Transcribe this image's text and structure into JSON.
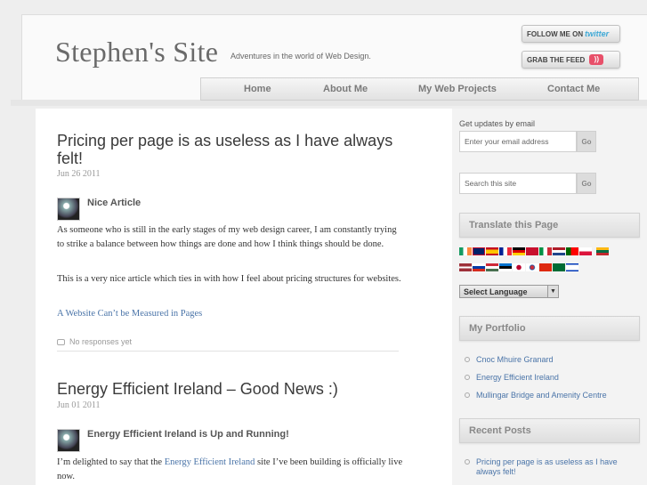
{
  "header": {
    "site_title": "Stephen's Site",
    "tagline": "Adventures in the world of Web Design.",
    "follow_label": "FOLLOW ME ON",
    "follow_brand": "twitter",
    "feed_label": "GRAB THE FEED"
  },
  "nav": {
    "items": [
      {
        "label": "Home"
      },
      {
        "label": "About Me"
      },
      {
        "label": "My Web Projects"
      },
      {
        "label": "Contact Me"
      }
    ]
  },
  "posts": [
    {
      "title": "Pricing per page is as useless as I have always felt!",
      "date": "Jun 26 2011",
      "subheading": "Nice Article",
      "paragraph1": "As someone who is still in the early stages of my web design career, I am constantly trying to strike a balance between how things are done and how I think things should be done.",
      "paragraph2": "This is a very nice article which ties in with how I feel about pricing structures for websites.",
      "link": "A Website Can’t be Measured in Pages",
      "comments": "No responses yet"
    },
    {
      "title": "Energy Efficient Ireland – Good News :)",
      "date": "Jun 01 2011",
      "subheading": "Energy Efficient Ireland is Up and Running!",
      "paragraph_before": "I’m delighted to say that the ",
      "paragraph_link": "Energy Efficient Ireland",
      "paragraph_after": " site I’ve been building is officially live now."
    }
  ],
  "sidebar": {
    "email_label": "Get updates by email",
    "email_placeholder": "Enter your email address",
    "go_label": "Go",
    "search_placeholder": "Search this site",
    "translate_title": "Translate this Page",
    "select_language": "Select Language",
    "portfolio_title": "My Portfolio",
    "portfolio_items": [
      {
        "label": "Cnoc Mhuire Granard"
      },
      {
        "label": "Energy Efficient Ireland"
      },
      {
        "label": "Mullingar Bridge and Amenity Centre"
      }
    ],
    "recent_title": "Recent Posts",
    "recent_items": [
      {
        "label": "Pricing per page is as useless as I have always felt!"
      }
    ]
  },
  "flags": [
    "ireland-flag-icon",
    "uk-flag-icon",
    "spain-flag-icon",
    "france-flag-icon",
    "germany-flag-icon",
    "denmark-flag-icon",
    "italy-flag-icon",
    "netherlands-flag-icon",
    "portugal-flag-icon",
    "poland-flag-icon",
    "lithuania-flag-icon",
    "latvia-flag-icon",
    "russia-flag-icon",
    "hungary-flag-icon",
    "estonia-flag-icon",
    "japan-flag-icon",
    "korea-flag-icon",
    "china-flag-icon",
    "saudi-flag-icon",
    "israel-flag-icon"
  ],
  "colors": {
    "link": "#4a74a8",
    "twitter": "#3fa9d6",
    "feed": "#e8506a"
  }
}
